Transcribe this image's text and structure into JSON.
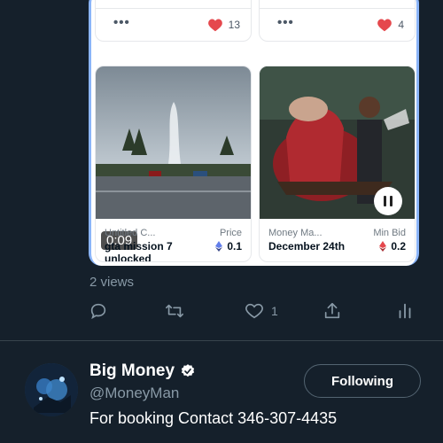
{
  "embed": {
    "top_cards": [
      {
        "likes": "13"
      },
      {
        "likes": "4"
      }
    ],
    "cards": [
      {
        "title": "Untitled C...",
        "name": "gta mission 7 unlocked",
        "price_label": "Price",
        "price": "0.1",
        "video_time": "0:09"
      },
      {
        "title": "Money Ma...",
        "name": "December 24th",
        "price_label": "Min Bid",
        "price": "0.2"
      }
    ]
  },
  "tweet": {
    "views": "2 views",
    "like_count": "1"
  },
  "profile": {
    "name": "Big Money",
    "handle": "@MoneyMan",
    "bio": "For booking Contact 346-307-4435",
    "follow_label": "Following"
  },
  "colors": {
    "background": "#15202b",
    "secondary_text": "#8899a6",
    "heart": "#e5484d",
    "verified": "#ffffff"
  }
}
